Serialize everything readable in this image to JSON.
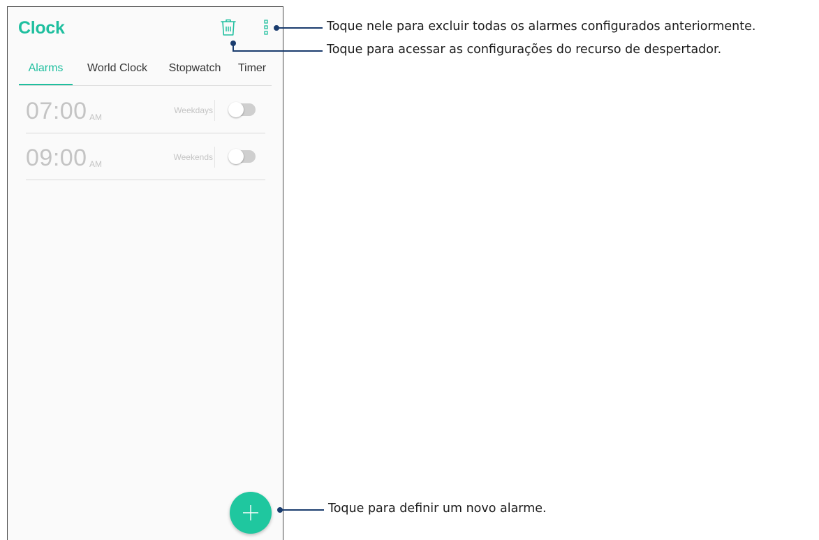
{
  "app": {
    "title": "Clock"
  },
  "tabs": [
    {
      "label": "Alarms",
      "active": true
    },
    {
      "label": "World Clock",
      "active": false
    },
    {
      "label": "Stopwatch",
      "active": false
    },
    {
      "label": "Timer",
      "active": false
    }
  ],
  "alarms": [
    {
      "time": "07:00",
      "ampm": "AM",
      "repeat": "Weekdays",
      "enabled": false
    },
    {
      "time": "09:00",
      "ampm": "AM",
      "repeat": "Weekends",
      "enabled": false
    }
  ],
  "icons": {
    "trash": "trash-icon",
    "menu": "more-vertical-icon",
    "add": "plus-icon"
  },
  "callouts": {
    "menu": "Toque nele para excluir todas os alarmes configurados anteriormente.",
    "trash": "Toque para acessar as configurações do recurso de despertador.",
    "fab": "Toque para definir um novo alarme."
  },
  "colors": {
    "accent": "#1fbf9f",
    "fab": "#1fc79f",
    "callout": "#1a3c6e",
    "muted_text": "#c4c4c4"
  }
}
